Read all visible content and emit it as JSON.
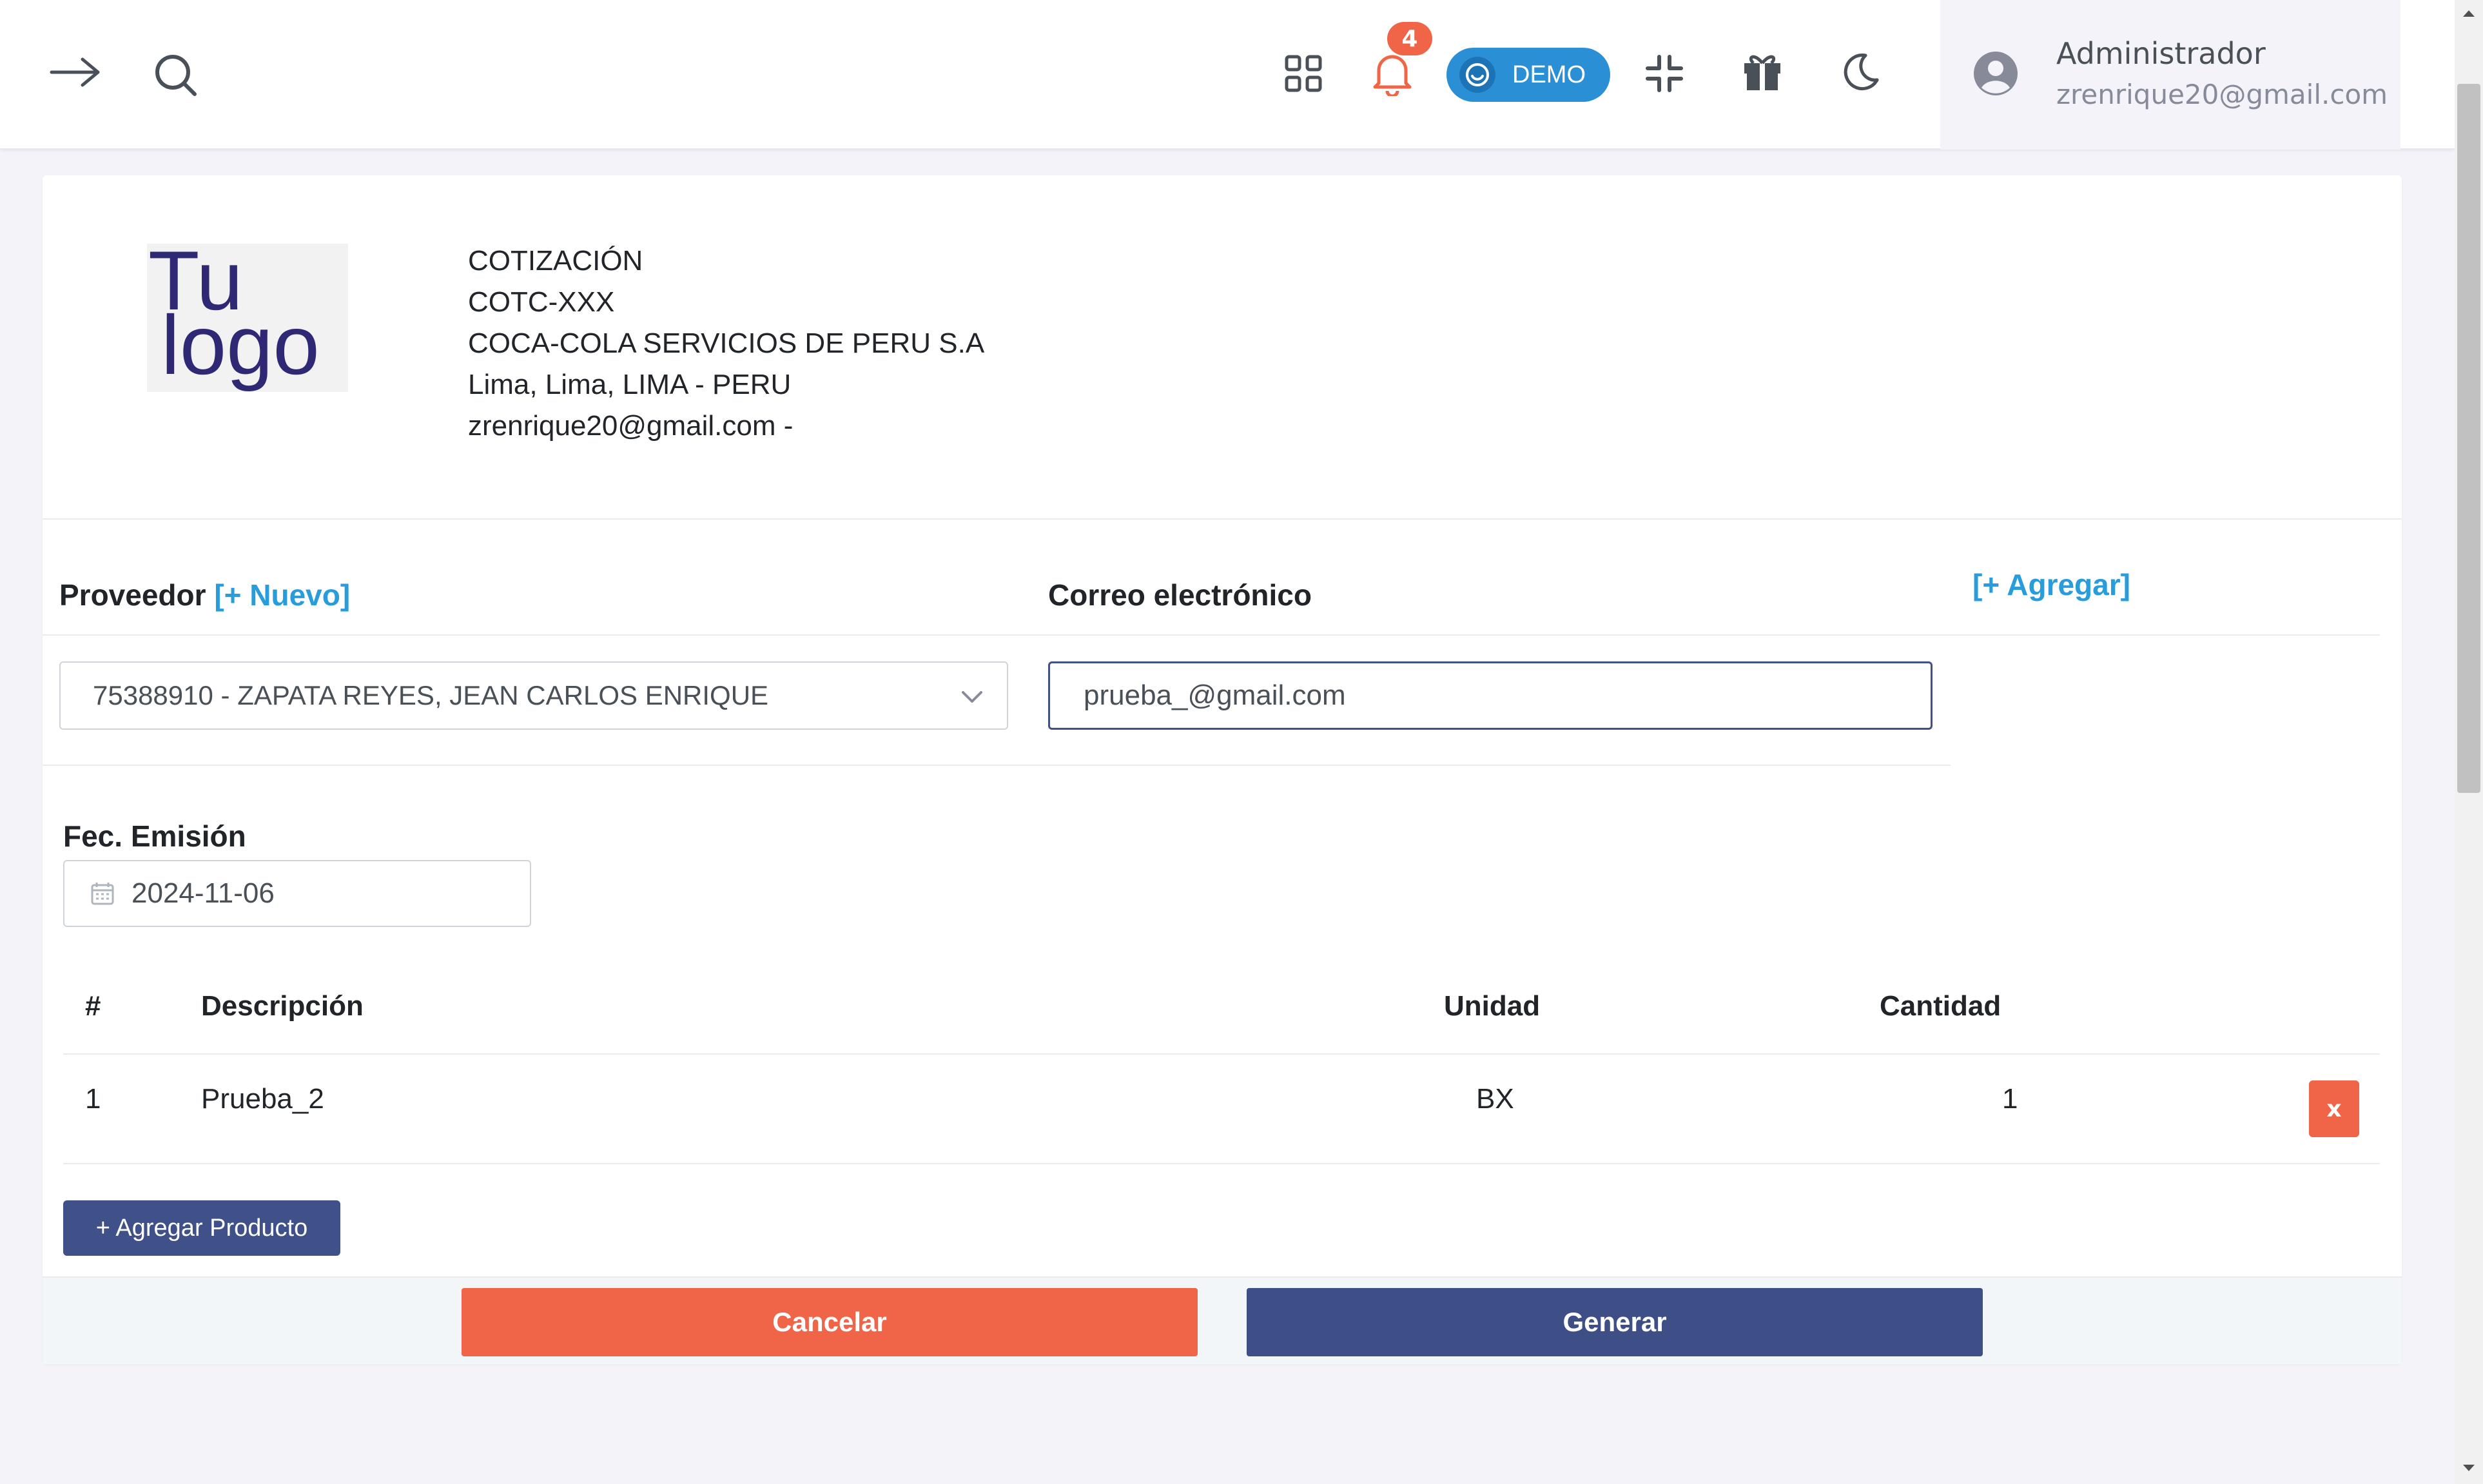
{
  "header": {
    "notifications_count": "4",
    "demo_label": "DEMO",
    "icons": [
      "arrow-right-icon",
      "search-icon",
      "apps-grid-icon",
      "bell-icon",
      "smile-icon",
      "minimize-icon",
      "gift-icon",
      "moon-icon",
      "user-avatar-icon"
    ],
    "user": {
      "name": "Administrador",
      "email": "zrenrique20@gmail.com"
    }
  },
  "document": {
    "logo_line1": "Tu",
    "logo_line2": "logo",
    "lines": [
      "COTIZACIÓN",
      "COTC-XXX",
      "COCA-COLA SERVICIOS DE PERU S.A",
      "Lima, Lima, LIMA - PERU",
      "zrenrique20@gmail.com -"
    ]
  },
  "form": {
    "proveedor_label": "Proveedor",
    "proveedor_new_link": "[+ Nuevo]",
    "proveedor_value": "75388910 - ZAPATA REYES, JEAN CARLOS ENRIQUE",
    "correo_label": "Correo electrónico",
    "correo_value": "prueba_@gmail.com",
    "agregar_link": "[+ Agregar]",
    "fecha_label": "Fec. Emisión",
    "fecha_value": "2024-11-06"
  },
  "table": {
    "headers": {
      "num": "#",
      "descripcion": "Descripción",
      "unidad": "Unidad",
      "cantidad": "Cantidad"
    },
    "rows": [
      {
        "num": "1",
        "descripcion": "Prueba_2",
        "unidad": "BX",
        "cantidad": "1",
        "delete_label": "x"
      }
    ]
  },
  "actions": {
    "add_product": "+ Agregar Producto",
    "cancel": "Cancelar",
    "generate": "Generar"
  },
  "colors": {
    "primary": "#405189",
    "danger": "#f06548",
    "info": "#299cdb",
    "page_bg": "#f3f3f9"
  }
}
